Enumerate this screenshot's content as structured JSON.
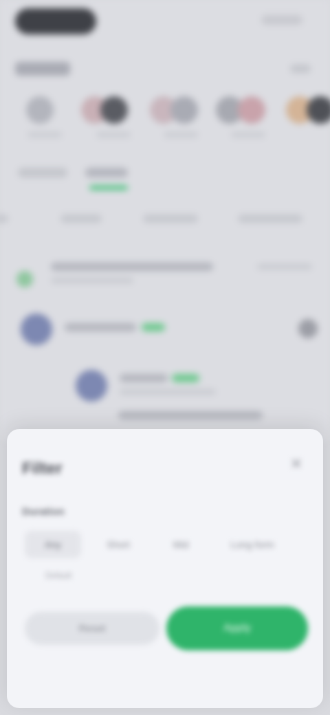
{
  "sheet": {
    "title": "Filter",
    "close_icon": "close-icon",
    "section_label": "Duration",
    "options": [
      "Any",
      "Short",
      "Mid",
      "Long form"
    ],
    "selected_option_sub": "Default",
    "reset_label": "Reset",
    "apply_label": "Apply"
  },
  "colors": {
    "accent": "#2fb46a",
    "sheet_bg": "#f3f4f8",
    "backdrop": "#dcdde2"
  }
}
